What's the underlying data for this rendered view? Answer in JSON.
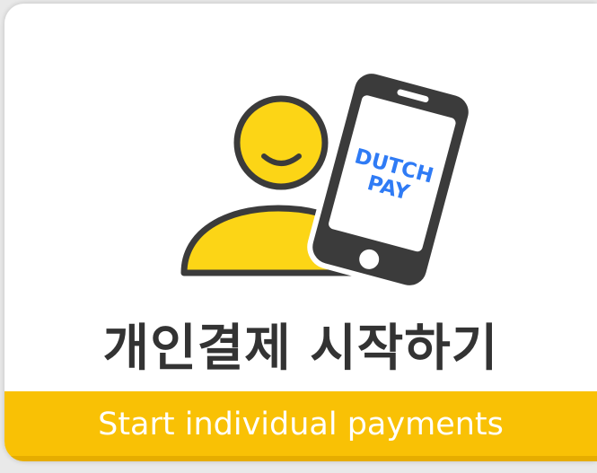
{
  "card": {
    "title": "개인결제 시작하기",
    "subtitle": "Start individual payments"
  },
  "phone_screen": {
    "line1": "DUTCH",
    "line2": "PAY"
  },
  "colors": {
    "accent_yellow": "#f9c105",
    "person_yellow": "#fcd516",
    "outline": "#3b3b3b",
    "logo_blue": "#2f7bf5",
    "title_text": "#333333"
  },
  "icons": [
    "person-icon",
    "smartphone-icon"
  ]
}
